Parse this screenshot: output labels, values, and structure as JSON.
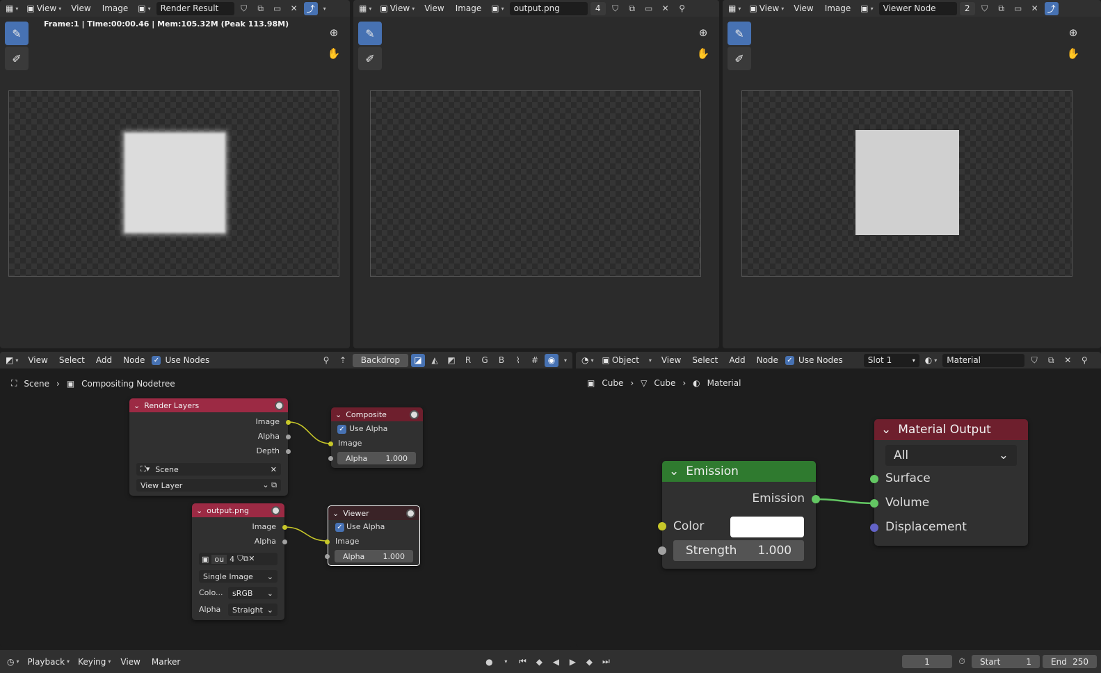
{
  "viewer1": {
    "view_menu": "View",
    "menu_view": "View",
    "menu_image": "Image",
    "image_name": "Render Result",
    "status": "Frame:1 | Time:00:00.46 | Mem:105.32M (Peak 113.98M)"
  },
  "viewer2": {
    "view_menu": "View",
    "menu_view": "View",
    "menu_image": "Image",
    "image_name": "output.png",
    "users": "4"
  },
  "viewer3": {
    "view_menu": "View",
    "menu_view": "View",
    "menu_image": "Image",
    "image_name": "Viewer Node",
    "users": "2"
  },
  "comp": {
    "menus": [
      "View",
      "Select",
      "Add",
      "Node"
    ],
    "use_nodes": "Use Nodes",
    "backdrop": "Backdrop",
    "channels": [
      "R",
      "G",
      "B"
    ],
    "breadcrumb": [
      "Scene",
      "Compositing Nodetree"
    ],
    "render_layers": {
      "title": "Render Layers",
      "outputs": [
        "Image",
        "Alpha",
        "Depth"
      ],
      "scene": "Scene",
      "view_layer": "View Layer"
    },
    "composite": {
      "title": "Composite",
      "use_alpha": "Use Alpha",
      "input": "Image",
      "alpha_label": "Alpha",
      "alpha_value": "1.000"
    },
    "output_png": {
      "title": "output.png",
      "outputs": [
        "Image",
        "Alpha"
      ],
      "image_short": "ou",
      "users": "4",
      "source": "Single Image",
      "color_label": "Colo...",
      "color_value": "sRGB",
      "alpha_label": "Alpha",
      "alpha_value": "Straight"
    },
    "viewer": {
      "title": "Viewer",
      "use_alpha": "Use Alpha",
      "input": "Image",
      "alpha_label": "Alpha",
      "alpha_value": "1.000"
    }
  },
  "shader": {
    "mode": "Object",
    "menus": [
      "View",
      "Select",
      "Add",
      "Node"
    ],
    "use_nodes": "Use Nodes",
    "slot": "Slot 1",
    "material": "Material",
    "breadcrumb": [
      "Cube",
      "Cube",
      "Material"
    ],
    "emission": {
      "title": "Emission",
      "output": "Emission",
      "color_label": "Color",
      "color_value": "#ffffff",
      "strength_label": "Strength",
      "strength_value": "1.000"
    },
    "material_output": {
      "title": "Material Output",
      "target": "All",
      "inputs": [
        "Surface",
        "Volume",
        "Displacement"
      ]
    }
  },
  "timeline": {
    "menus": [
      "Playback",
      "Keying",
      "View",
      "Marker"
    ],
    "current_frame": "1",
    "start_label": "Start",
    "start": "1",
    "end_label": "End",
    "end": "250"
  },
  "colors": {
    "accent": "#4772b3",
    "composite_header": "#9c2a44",
    "emission_header": "#2f7a2f",
    "output_header": "#6e1f2d",
    "socket_yellow": "#c7c729",
    "socket_green": "#63c763",
    "socket_violet": "#6363c7"
  }
}
